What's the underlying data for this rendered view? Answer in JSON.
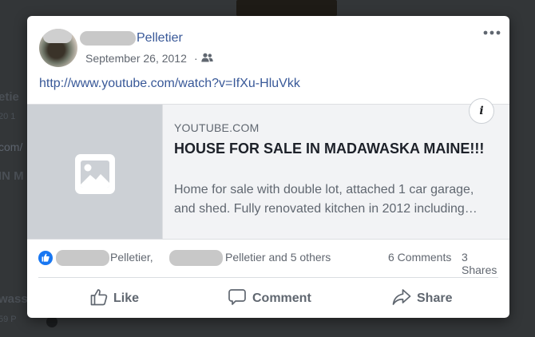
{
  "background": {
    "fragments": [
      "etie",
      "20 1",
      "com/",
      "IN M",
      "wass",
      "59 P"
    ]
  },
  "post": {
    "author_name": "Pelletier",
    "date": "September 26, 2012",
    "date_separator": "·",
    "audience_icon": "friends-icon",
    "more_icon": "more-horizontal-icon",
    "link": "http://www.youtube.com/watch?v=IfXu-HluVkk"
  },
  "preview": {
    "image_icon": "image-placeholder-icon",
    "info_label": "i",
    "domain": "YOUTUBE.COM",
    "title": "HOUSE FOR SALE IN MADAWASKA MAINE!!!",
    "description_line1": "Home for sale with double lot, attached 1 car garage,",
    "description_line2": "and shed. Fully renovated kitchen in 2012 including…"
  },
  "reactions": {
    "icon": "like-reaction-icon",
    "name1_suffix": "Pelletier,",
    "name2_suffix": "Pelletier and 5 others",
    "comments": "6 Comments",
    "shares": "3 Shares"
  },
  "actions": {
    "like": "Like",
    "comment": "Comment",
    "share": "Share"
  },
  "colors": {
    "link": "#385898",
    "like_blue": "#1877f2",
    "overlay": "#333638"
  }
}
